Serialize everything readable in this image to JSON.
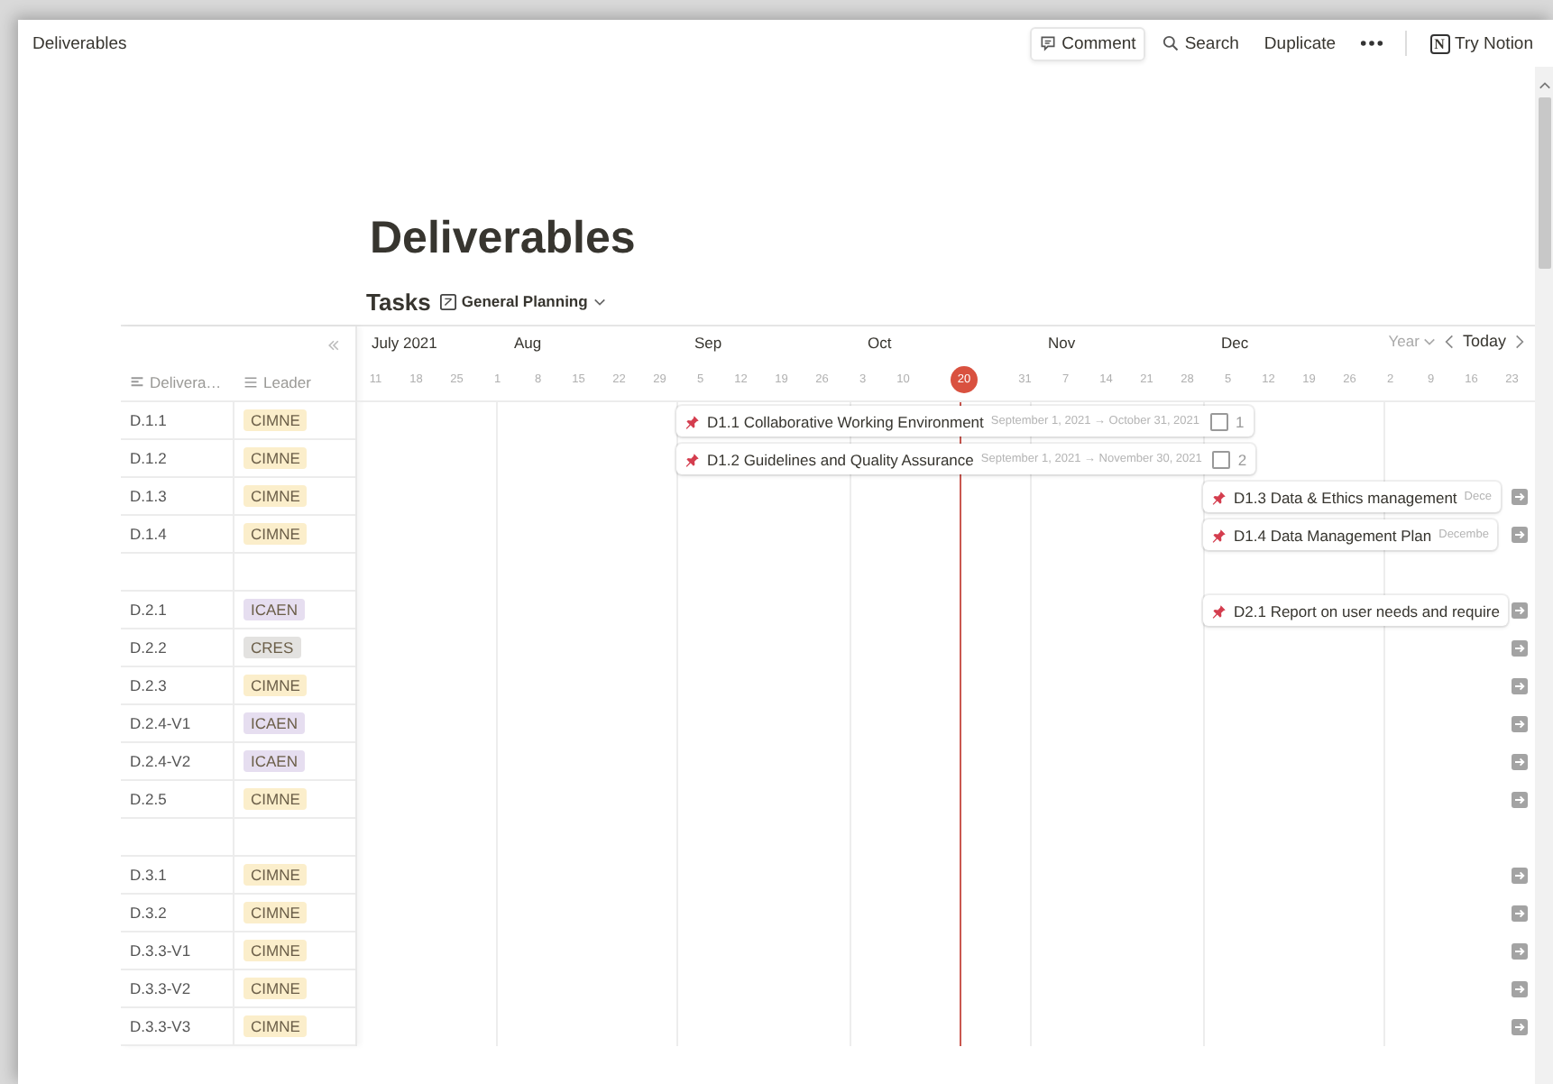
{
  "topbar": {
    "breadcrumb": "Deliverables",
    "comment": "Comment",
    "search": "Search",
    "duplicate": "Duplicate",
    "logo_letter": "N",
    "try": "Try Notion"
  },
  "page": {
    "title": "Deliverables"
  },
  "view": {
    "name": "Tasks",
    "view_name": "General Planning"
  },
  "timeline": {
    "months": [
      {
        "label": "July 2021"
      },
      {
        "label": "Aug"
      },
      {
        "label": "Sep"
      },
      {
        "label": "Oct"
      },
      {
        "label": "Nov"
      },
      {
        "label": "Dec"
      }
    ],
    "ticks": [
      {
        "label": "11",
        "today": false
      },
      {
        "label": "18",
        "today": false
      },
      {
        "label": "25",
        "today": false
      },
      {
        "label": "1",
        "today": false
      },
      {
        "label": "8",
        "today": false
      },
      {
        "label": "15",
        "today": false
      },
      {
        "label": "22",
        "today": false
      },
      {
        "label": "29",
        "today": false
      },
      {
        "label": "5",
        "today": false
      },
      {
        "label": "12",
        "today": false
      },
      {
        "label": "19",
        "today": false
      },
      {
        "label": "26",
        "today": false
      },
      {
        "label": "3",
        "today": false
      },
      {
        "label": "10",
        "today": false
      },
      {
        "label": "20",
        "today": true
      },
      {
        "label": "31",
        "today": false
      },
      {
        "label": "7",
        "today": false
      },
      {
        "label": "14",
        "today": false
      },
      {
        "label": "21",
        "today": false
      },
      {
        "label": "28",
        "today": false
      },
      {
        "label": "5",
        "today": false
      },
      {
        "label": "12",
        "today": false
      },
      {
        "label": "19",
        "today": false
      },
      {
        "label": "26",
        "today": false
      },
      {
        "label": "2",
        "today": false
      },
      {
        "label": "9",
        "today": false
      },
      {
        "label": "16",
        "today": false
      },
      {
        "label": "23",
        "today": false
      }
    ],
    "zoom": "Year",
    "today_button": "Today"
  },
  "columns": [
    {
      "label": "Delivera…",
      "kind": "title"
    },
    {
      "label": "Leader",
      "kind": "select"
    }
  ],
  "rows": [
    {
      "kind": "item",
      "id": "D.1.1",
      "leader": "CIMNE",
      "color": "#fbeecb",
      "offscreen": false,
      "bar": {
        "title": "D1.1 Collaborative Working Environment",
        "dates": "September 1, 2021 → October 31, 2021",
        "checked": false,
        "number": "1"
      }
    },
    {
      "kind": "item",
      "id": "D.1.2",
      "leader": "CIMNE",
      "color": "#fbeecb",
      "offscreen": false,
      "bar": {
        "title": "D1.2 Guidelines and Quality Assurance",
        "dates": "September 1, 2021 → November 30, 2021",
        "checked": false,
        "number": "2"
      }
    },
    {
      "kind": "item",
      "id": "D.1.3",
      "leader": "CIMNE",
      "color": "#fbeecb",
      "offscreen": true,
      "bar": {
        "title": "D1.3 Data & Ethics management",
        "dates": "Dece"
      }
    },
    {
      "kind": "item",
      "id": "D.1.4",
      "leader": "CIMNE",
      "color": "#fbeecb",
      "offscreen": true,
      "bar": {
        "title": "D1.4 Data Management Plan",
        "dates": "Decembe"
      }
    },
    {
      "kind": "blank"
    },
    {
      "kind": "item",
      "id": "D.2.1",
      "leader": "ICAEN",
      "color": "#e6def0",
      "offscreen": true,
      "bar": {
        "title": "D2.1 Report on user needs and require"
      }
    },
    {
      "kind": "item",
      "id": "D.2.2",
      "leader": "CRES",
      "color": "#e3e2e0",
      "offscreen": true
    },
    {
      "kind": "item",
      "id": "D.2.3",
      "leader": "CIMNE",
      "color": "#fbeecb",
      "offscreen": true
    },
    {
      "kind": "item",
      "id": "D.2.4-V1",
      "leader": "ICAEN",
      "color": "#e6def0",
      "offscreen": true
    },
    {
      "kind": "item",
      "id": "D.2.4-V2",
      "leader": "ICAEN",
      "color": "#e6def0",
      "offscreen": true
    },
    {
      "kind": "item",
      "id": "D.2.5",
      "leader": "CIMNE",
      "color": "#fbeecb",
      "offscreen": true
    },
    {
      "kind": "blank"
    },
    {
      "kind": "item",
      "id": "D.3.1",
      "leader": "CIMNE",
      "color": "#fbeecb",
      "offscreen": true
    },
    {
      "kind": "item",
      "id": "D.3.2",
      "leader": "CIMNE",
      "color": "#fbeecb",
      "offscreen": true
    },
    {
      "kind": "item",
      "id": "D.3.3-V1",
      "leader": "CIMNE",
      "color": "#fbeecb",
      "offscreen": true
    },
    {
      "kind": "item",
      "id": "D.3.3-V2",
      "leader": "CIMNE",
      "color": "#fbeecb",
      "offscreen": true
    },
    {
      "kind": "item",
      "id": "D.3.3-V3",
      "leader": "CIMNE",
      "color": "#fbeecb",
      "offscreen": true
    }
  ]
}
